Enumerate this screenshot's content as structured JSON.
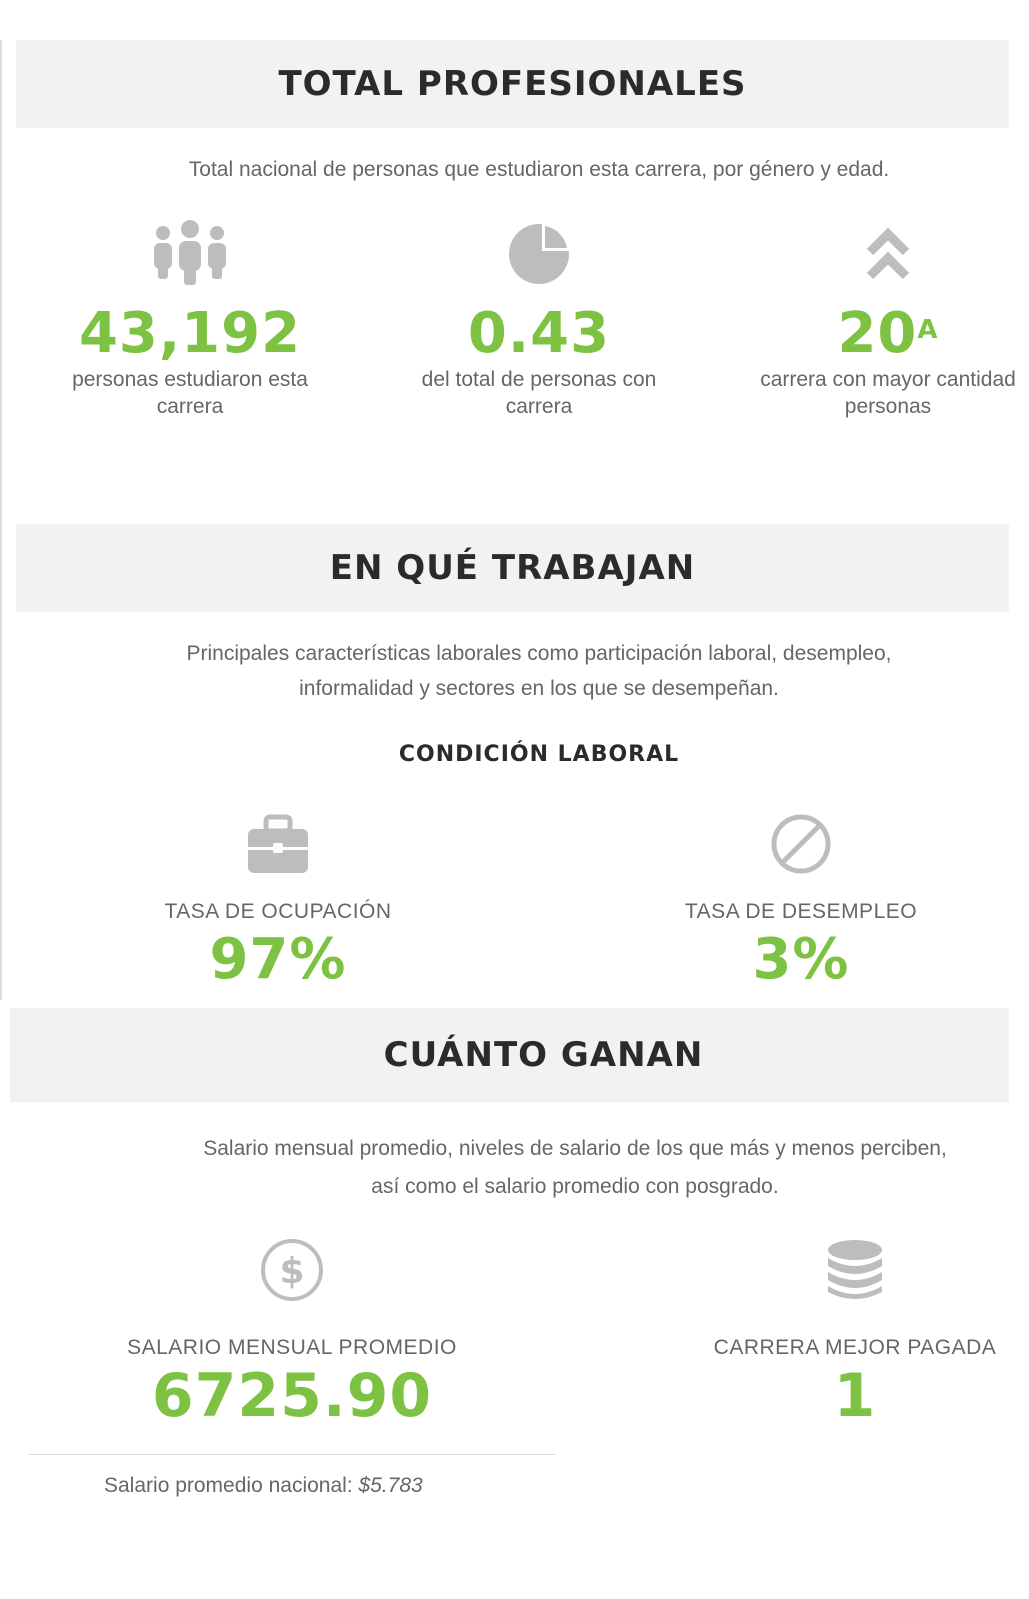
{
  "sections": {
    "total": {
      "title": "TOTAL PROFESIONALES",
      "intro": "Total nacional de personas que estudiaron esta carrera, por género y edad.",
      "stats": [
        {
          "icon": "people-icon",
          "value": "43,192",
          "desc_line1": "personas estudiaron esta",
          "desc_line2": "carrera"
        },
        {
          "icon": "pie-chart-icon",
          "value": "0.43",
          "desc_line1": "del total de personas con",
          "desc_line2": "carrera"
        },
        {
          "icon": "double-chevron-up-icon",
          "value": "20",
          "value_sup": "A",
          "desc_line1": "carrera con mayor cantidad",
          "desc_line2": "personas"
        }
      ]
    },
    "work": {
      "title": "EN QUÉ TRABAJAN",
      "intro_line1": "Principales características laborales como participación laboral, desempleo,",
      "intro_line2": "informalidad y sectores en los que se desempeñan.",
      "subhead": "CONDICIÓN LABORAL",
      "stats": [
        {
          "icon": "briefcase-icon",
          "label": "TASA DE OCUPACIÓN",
          "value": "97%"
        },
        {
          "icon": "prohibited-icon",
          "label": "TASA DE DESEMPLEO",
          "value": "3%"
        }
      ]
    },
    "earn": {
      "title": "CUÁNTO GANAN",
      "intro_line1": "Salario mensual promedio, niveles de salario de los que más y menos perciben,",
      "intro_line2": "así como el salario promedio con posgrado.",
      "stats": [
        {
          "icon": "dollar-coin-icon",
          "label": "SALARIO MENSUAL PROMEDIO",
          "value": "6725.90"
        },
        {
          "icon": "coin-stack-icon",
          "label": "CARRERA MEJOR PAGADA",
          "value": "1"
        }
      ],
      "footnote_label": "Salario promedio nacional: ",
      "footnote_value": "$5.783"
    }
  },
  "colors": {
    "accent": "#7dc242",
    "band": "#f2f2f2",
    "icon": "#bdbdbd",
    "heading": "#2b2b2b"
  }
}
